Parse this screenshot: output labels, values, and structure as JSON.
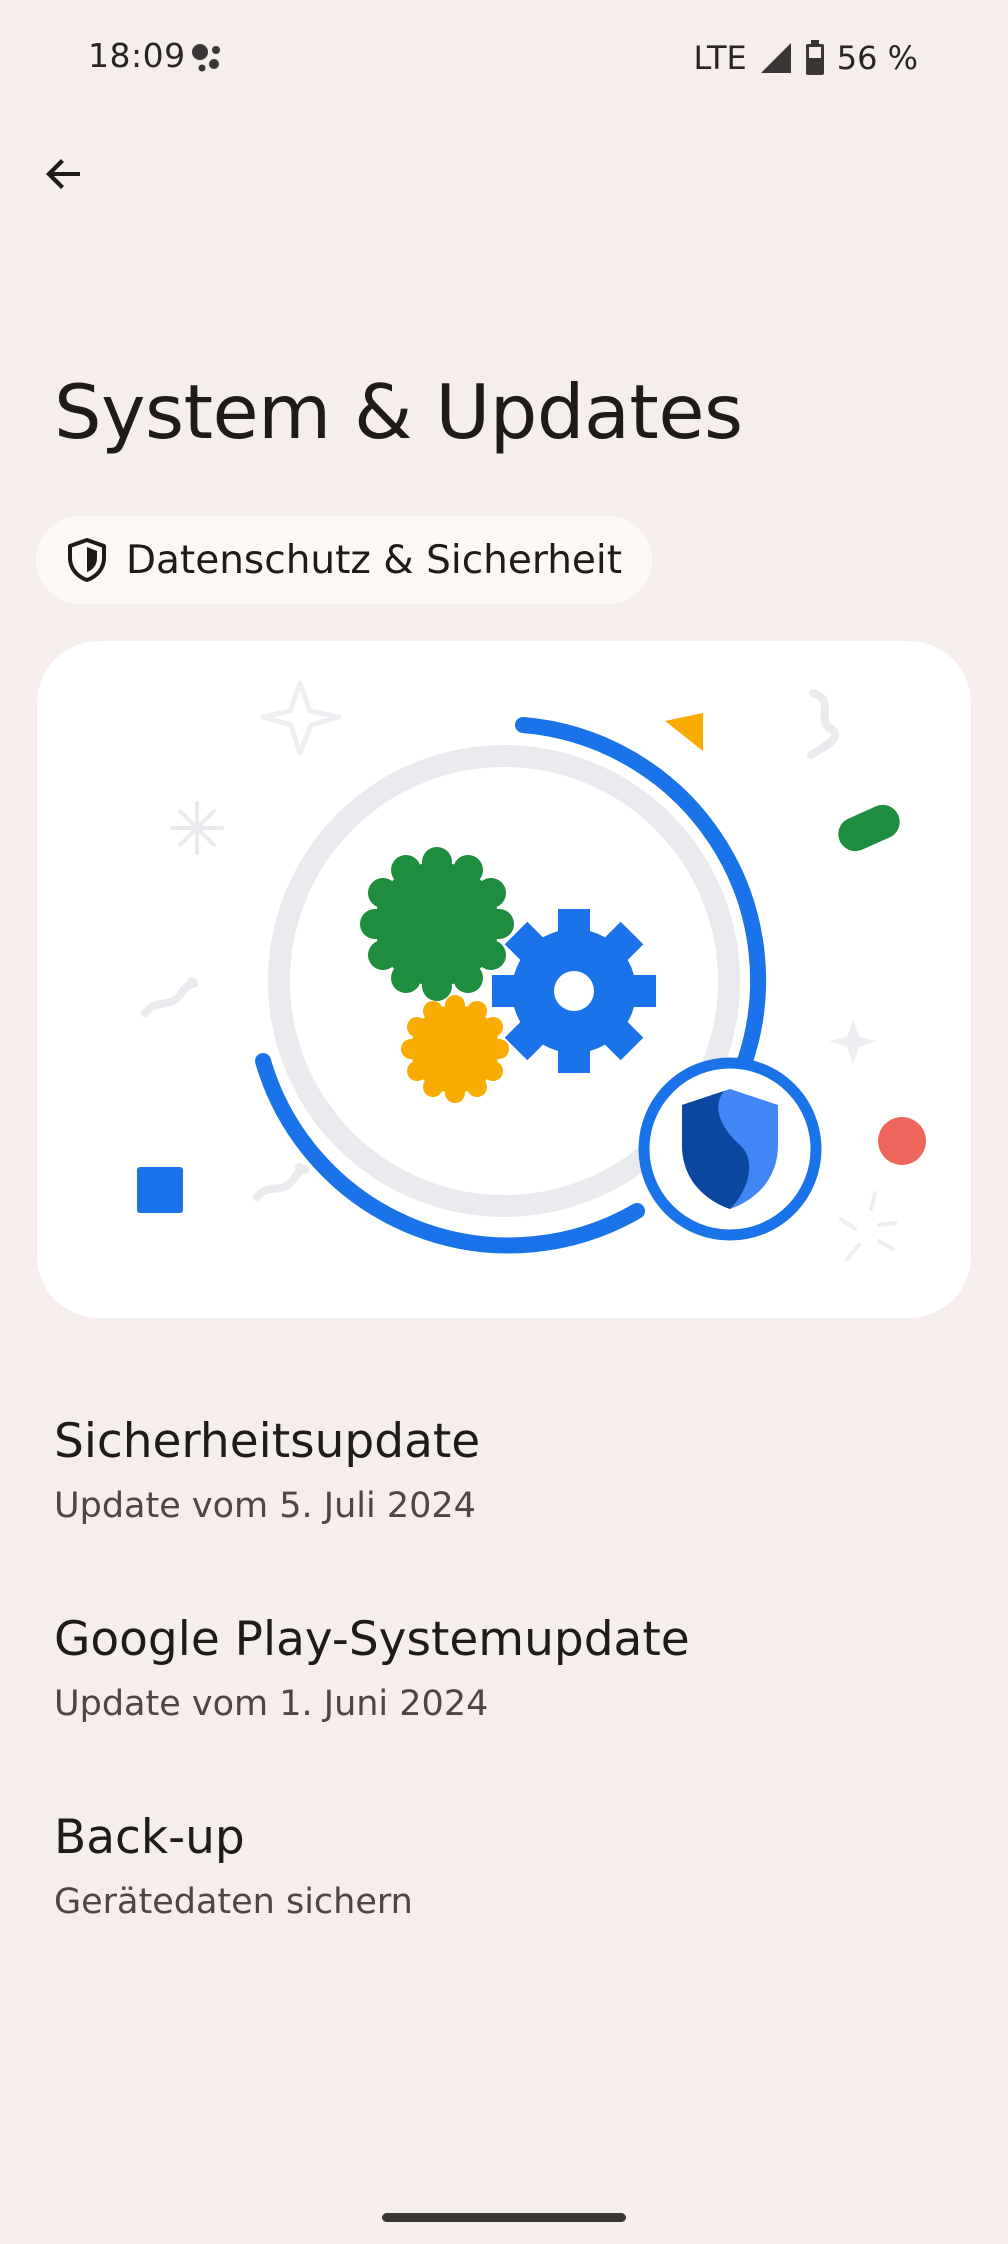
{
  "status_bar": {
    "time": "18:09",
    "network": "LTE",
    "battery": "56 %"
  },
  "header": {
    "back_label": "Zurück",
    "title": "System & Updates"
  },
  "breadcrumb": {
    "label": "Datenschutz & Sicherheit",
    "icon": "shield-outline-icon"
  },
  "hero": {
    "colors": {
      "blue": "#1a73e8",
      "green": "#1e8e3e",
      "yellow": "#f9ab00",
      "red": "#ee675c",
      "ring_grey": "#e8eaed"
    }
  },
  "items": [
    {
      "title": "Sicherheitsupdate",
      "subtitle": "Update vom 5. Juli 2024"
    },
    {
      "title": "Google Play-Systemupdate",
      "subtitle": "Update vom 1. Juni 2024"
    },
    {
      "title": "Back-up",
      "subtitle": "Gerätedaten sichern"
    }
  ]
}
